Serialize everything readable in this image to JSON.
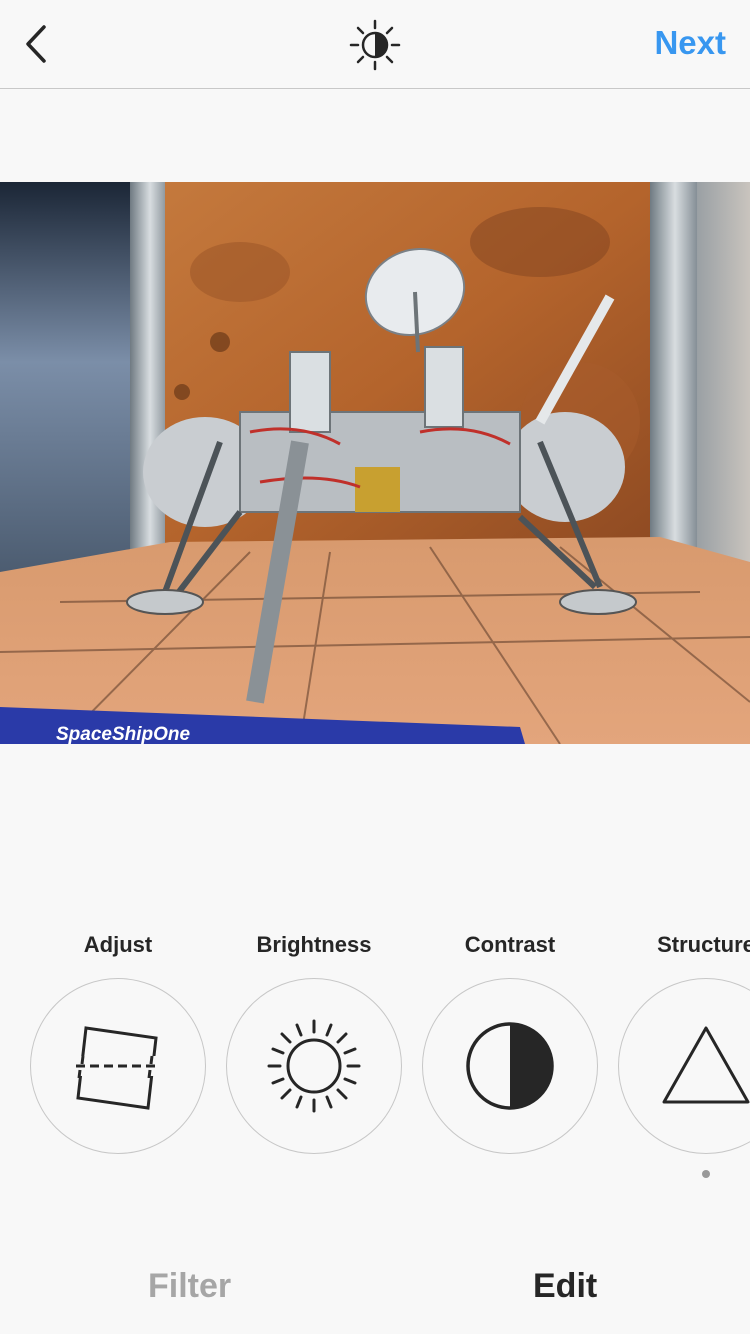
{
  "header": {
    "back_icon": "chevron-left-icon",
    "center_icon": "lux-sun-icon",
    "next_label": "Next",
    "accent_color": "#3897f0"
  },
  "photo": {
    "caption_sign": "SpaceShipOne"
  },
  "tools": [
    {
      "label": "Adjust",
      "icon": "adjust-icon"
    },
    {
      "label": "Brightness",
      "icon": "brightness-icon"
    },
    {
      "label": "Contrast",
      "icon": "contrast-icon"
    },
    {
      "label": "Structure",
      "icon": "structure-icon"
    }
  ],
  "tabs": {
    "filter": "Filter",
    "edit": "Edit",
    "active": "Edit"
  }
}
